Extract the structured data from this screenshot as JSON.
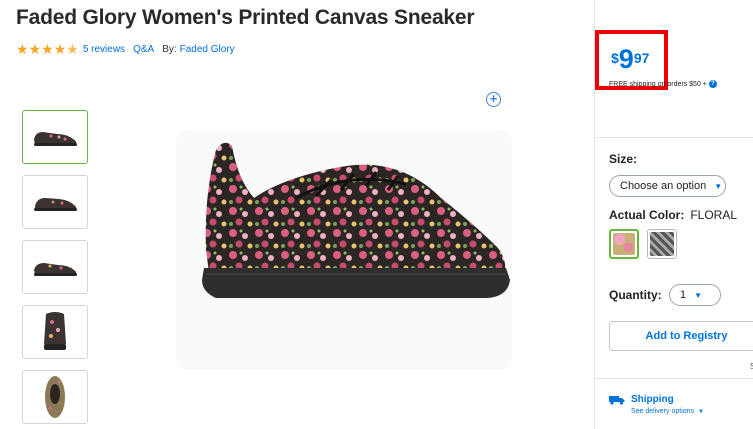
{
  "product": {
    "title": "Faded Glory Women's Printed Canvas Sneaker",
    "rating": 4.5,
    "reviews_label": "5 reviews",
    "qa_label": "Q&A",
    "by_label": "By:",
    "brand": "Faded Glory"
  },
  "icons": {
    "zoom": "plus-circle-icon",
    "help": "question-icon",
    "shipping": "truck-icon",
    "chevron": "chevron-down-icon"
  },
  "price": {
    "dollar_sign": "$",
    "whole": "9",
    "cents": "97",
    "shipping_note": "FREE shipping on orders $50 +",
    "help_glyph": "?"
  },
  "options": {
    "size_label": "Size:",
    "size_placeholder": "Choose an option",
    "color_label": "Actual Color:",
    "color_value": "FLORAL",
    "quantity_label": "Quantity:",
    "quantity_value": "1"
  },
  "actions": {
    "registry_label": "Add to Registry",
    "partial_text": "S"
  },
  "shipping": {
    "title": "Shipping",
    "link": "See delivery options"
  },
  "colors": {
    "accent": "#0071dc",
    "highlight": "#ee0000",
    "selected": "#6db33f",
    "star": "#f5a623"
  }
}
